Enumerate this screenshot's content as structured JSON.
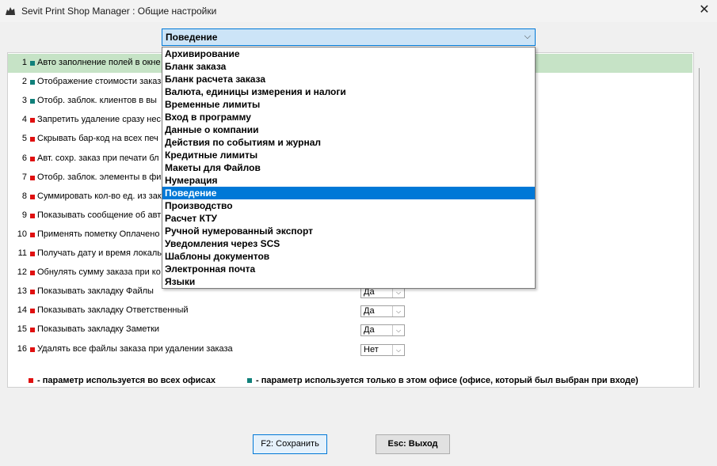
{
  "window": {
    "title": "Sevit Print Shop Manager : Общие настройки",
    "close_glyph": "✕"
  },
  "category_select": {
    "value": "Поведение",
    "arrow_glyph": "⌵",
    "options": [
      "Архивирование",
      "Бланк заказа",
      "Бланк расчета заказа",
      "Валюта, единицы измерения и налоги",
      "Временные лимиты",
      "Вход в программу",
      "Данные о компании",
      "Действия по событиям и журнал",
      "Кредитные лимиты",
      "Макеты для Файлов",
      "Нумерация",
      "Поведение",
      "Производство",
      "Расчет КТУ",
      "Ручной нумерованный экспорт",
      "Уведомления через SCS",
      "Шаблоны документов",
      "Электронная почта",
      "Языки"
    ],
    "selected_index": 11
  },
  "settings": [
    {
      "num": "1",
      "label": "Авто заполнение полей в окне",
      "scope": "teal",
      "value": ""
    },
    {
      "num": "2",
      "label": "Отображение стоимости заказа",
      "scope": "teal",
      "value": ""
    },
    {
      "num": "3",
      "label": "Отобр. заблок. клиентов в вы",
      "scope": "teal",
      "value": ""
    },
    {
      "num": "4",
      "label": "Запретить удаление сразу нес",
      "scope": "red",
      "value": ""
    },
    {
      "num": "5",
      "label": "Скрывать бар-код на всех печ",
      "scope": "red",
      "value": ""
    },
    {
      "num": "6",
      "label": "Авт. сохр. заказ при печати бл",
      "scope": "red",
      "value": ""
    },
    {
      "num": "7",
      "label": "Отобр. заблок. элементы в фи",
      "scope": "red",
      "value": ""
    },
    {
      "num": "8",
      "label": "Суммировать кол-во ед. из зак",
      "scope": "red",
      "value": ""
    },
    {
      "num": "9",
      "label": "Показывать сообщение об авт",
      "scope": "red",
      "value": ""
    },
    {
      "num": "10",
      "label": "Применять пометку Оплачено",
      "scope": "red",
      "value": ""
    },
    {
      "num": "11",
      "label": "Получать дату и время локаль",
      "scope": "red",
      "value": ""
    },
    {
      "num": "12",
      "label": "Обнулять сумму заказа при ко",
      "scope": "red",
      "value": ""
    },
    {
      "num": "13",
      "label": "Показывать закладку Файлы",
      "scope": "red",
      "value": "Да"
    },
    {
      "num": "14",
      "label": "Показывать закладку Ответственный",
      "scope": "red",
      "value": "Да"
    },
    {
      "num": "15",
      "label": "Показывать закладку Заметки",
      "scope": "red",
      "value": "Да"
    },
    {
      "num": "16",
      "label": "Удалять все файлы заказа при удалении заказа",
      "scope": "red",
      "value": "Нет"
    }
  ],
  "legend": {
    "all_offices": "- параметр используется во всех офисах",
    "this_office": "- параметр используется только в этом офисе (офисе, который был выбран при входе)"
  },
  "buttons": {
    "save": "F2: Сохранить",
    "exit": "Esc: Выход"
  },
  "colors": {
    "red_marker": "#e01010",
    "teal_marker": "#10807a",
    "highlight_row": "#c6e3c6",
    "selection": "#0078d7"
  }
}
